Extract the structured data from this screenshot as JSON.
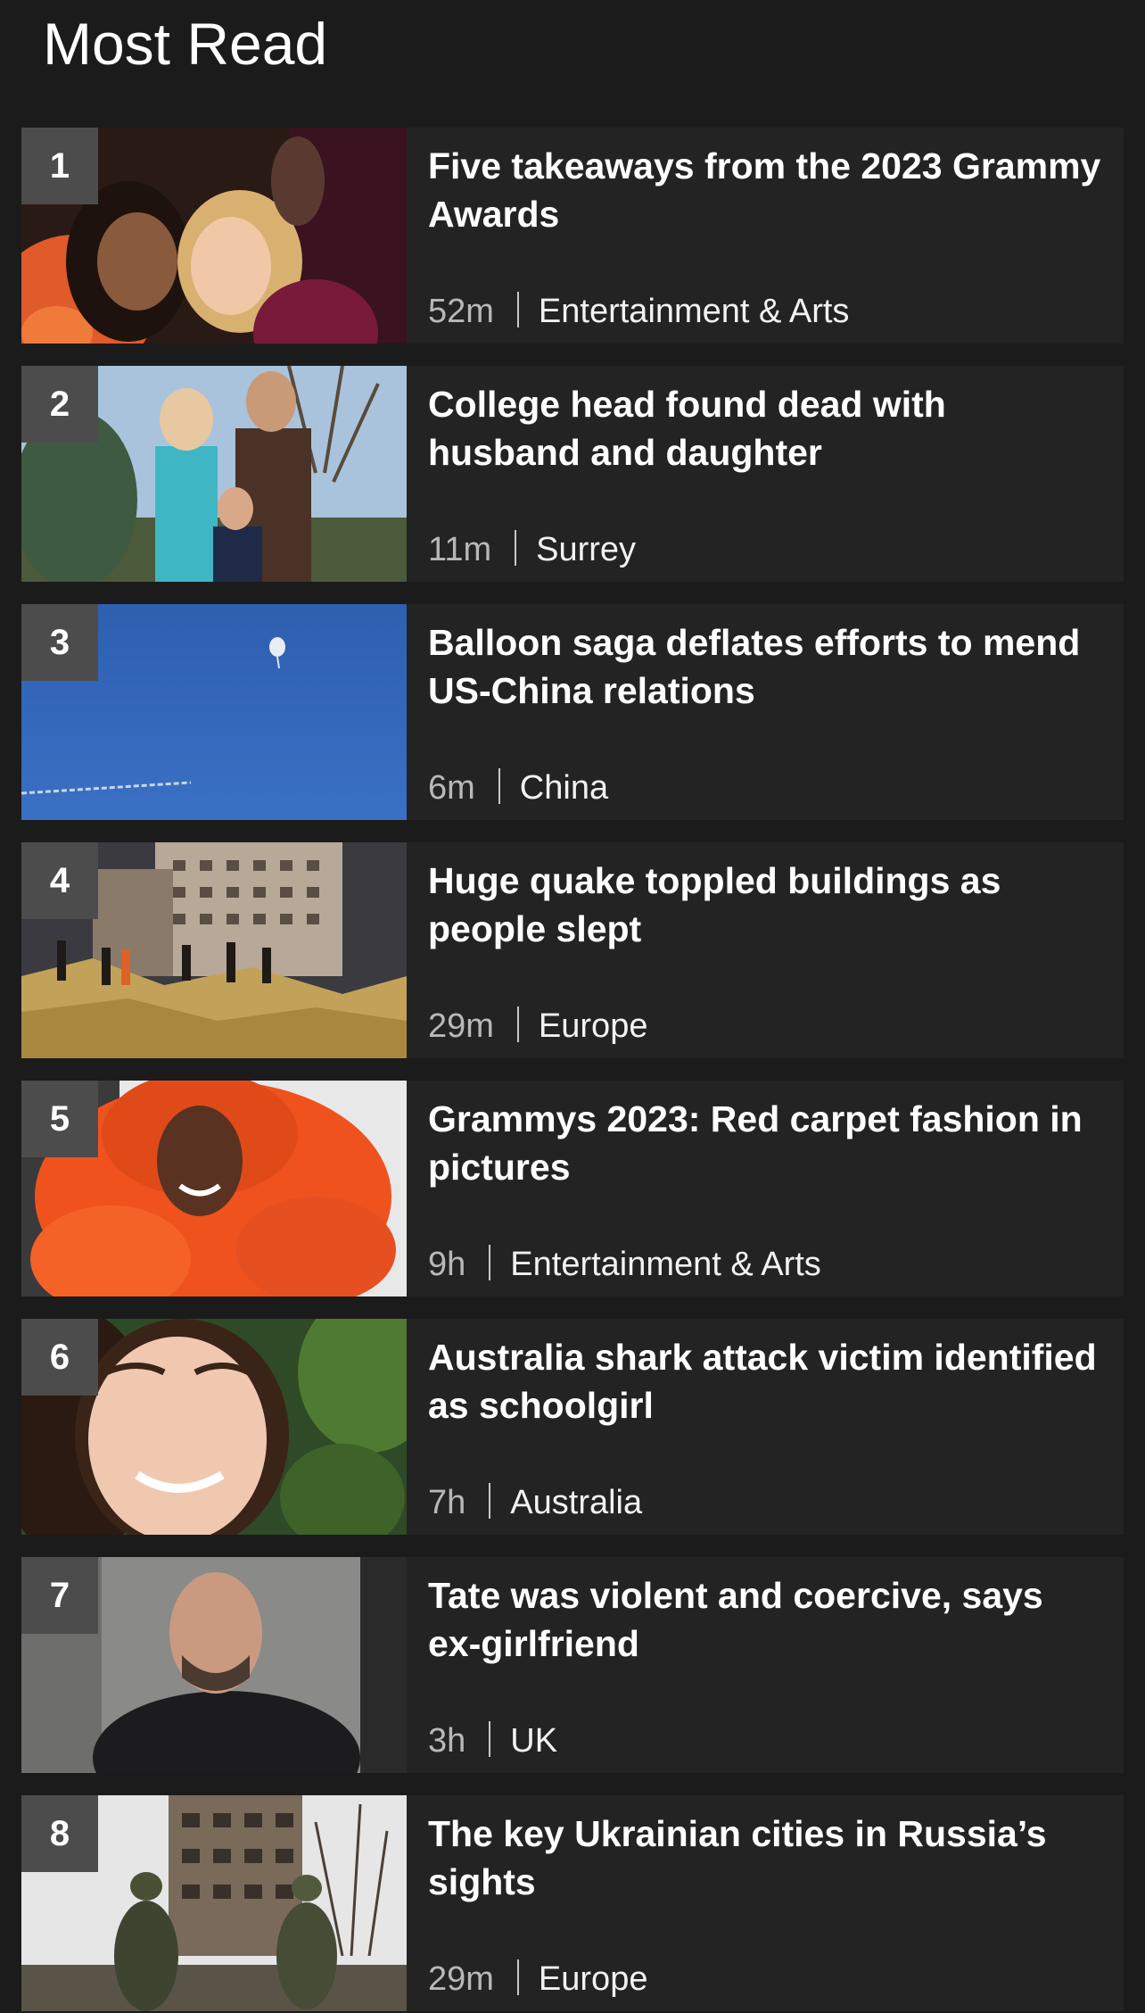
{
  "section_title": "Most Read",
  "colors": {
    "page_background": "#1b1b1b",
    "card_background": "#232323",
    "rank_badge": "#4c4c4c",
    "headline_text": "#ffffff",
    "time_text": "#b8b8b8"
  },
  "articles": [
    {
      "rank": "1",
      "headline": "Five takeaways from the 2023 Grammy Awards",
      "time": "52m",
      "category": "Entertainment & Arts",
      "image": "two-women-at-grammys-photo"
    },
    {
      "rank": "2",
      "headline": "College head found dead with husband and daughter",
      "time": "11m",
      "category": "Surrey",
      "image": "family-portrait-photo"
    },
    {
      "rank": "3",
      "headline": "Balloon saga deflates efforts to mend US-China relations",
      "time": "6m",
      "category": "China",
      "image": "balloon-in-blue-sky-photo"
    },
    {
      "rank": "4",
      "headline": "Huge quake toppled buildings as people slept",
      "time": "29m",
      "category": "Europe",
      "image": "collapsed-buildings-rescue-photo"
    },
    {
      "rank": "5",
      "headline": "Grammys 2023: Red carpet fashion in pictures",
      "time": "9h",
      "category": "Entertainment & Arts",
      "image": "red-carpet-orange-gown-photo"
    },
    {
      "rank": "6",
      "headline": "Australia shark attack victim identified as schoolgirl",
      "time": "7h",
      "category": "Australia",
      "image": "smiling-girl-portrait-photo"
    },
    {
      "rank": "7",
      "headline": "Tate was violent and coercive, says ex-girlfriend",
      "time": "3h",
      "category": "UK",
      "image": "man-in-black-hoodie-photo"
    },
    {
      "rank": "8",
      "headline": "The key Ukrainian cities in Russia’s sights",
      "time": "29m",
      "category": "Europe",
      "image": "soldiers-near-damaged-building-photo"
    }
  ]
}
